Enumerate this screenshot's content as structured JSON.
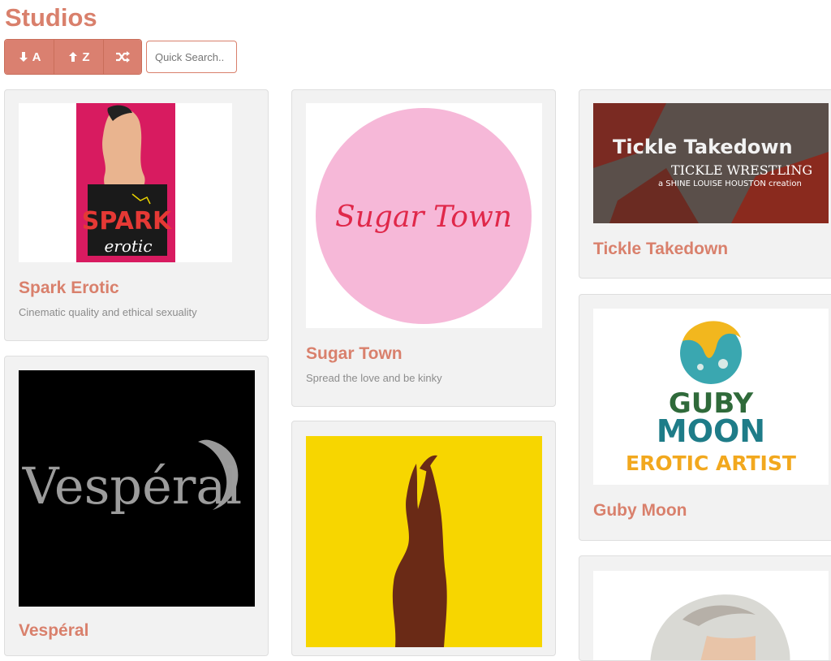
{
  "page": {
    "title": "Studios"
  },
  "toolbar": {
    "sort_asc_label": "A",
    "sort_desc_label": "Z",
    "search_placeholder": "Quick Search.."
  },
  "studios": [
    {
      "name": "Spark Erotic",
      "description": "Cinematic quality and ethical sexuality",
      "logo_text_1": "SPARK",
      "logo_text_2": "erotic"
    },
    {
      "name": "Sugar Town",
      "description": "Spread the love and be kinky",
      "logo_text": "Sugar Town"
    },
    {
      "name": "Tickle Takedown",
      "description": "",
      "logo_text_1": "Tickle Takedown",
      "logo_text_2": "TICKLE WRESTLING",
      "logo_text_3": "a SHINE LOUISE HOUSTON creation"
    },
    {
      "name": "Vespéral",
      "description": "",
      "logo_text": "Vespéral"
    },
    {
      "name": "",
      "description": ""
    },
    {
      "name": "Guby Moon",
      "description": "",
      "logo_text_1": "GUBY",
      "logo_text_2": "MOON",
      "logo_text_3": "EROTIC ARTIST"
    },
    {
      "name": "",
      "description": ""
    }
  ],
  "colors": {
    "accent": "#d9806c",
    "card_bg": "#f2f2f2"
  }
}
